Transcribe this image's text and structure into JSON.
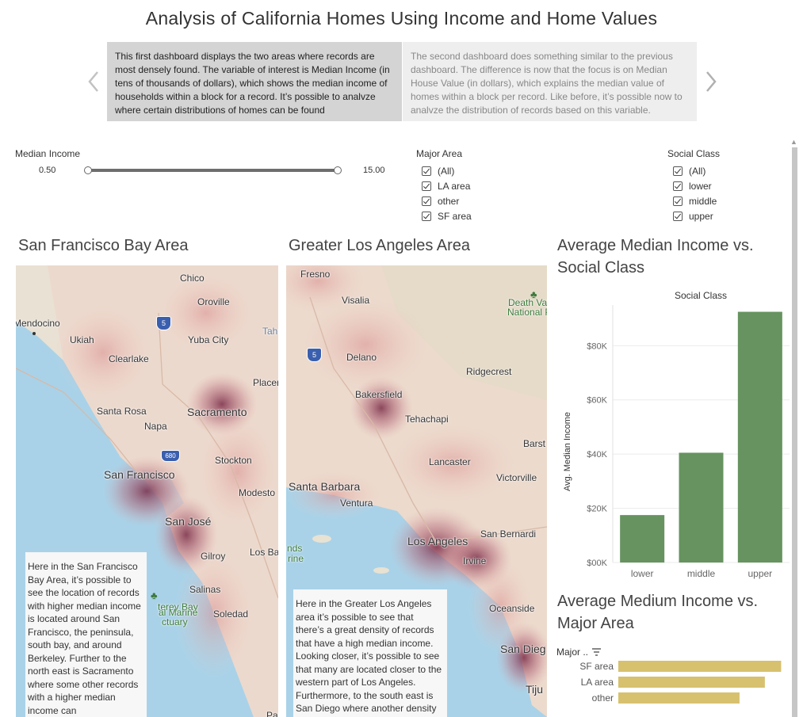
{
  "title": "Analysis of California Homes Using Income and Home Values",
  "story": {
    "prev_icon": "chevron-left-icon",
    "next_icon": "chevron-right-icon",
    "points": [
      "This first dashboard displays the two areas where records are most densely found. The variable of interest is Median Income (in tens of thousands of dollars), which shows the median income of households within a block for a record. It’s possible to analvze where certain distributions of homes can be found",
      "The second dashboard does something similar to the previous dashboard. The difference is now that the focus is on Median House Value (in dollars), which explains the median value of homes within a block per record. Like before, it’s possible now to analvze the distribution of records based on this variable."
    ]
  },
  "filters": {
    "median_income": {
      "title": "Median Income",
      "min_label": "0.50",
      "max_label": "15.00",
      "selected_fraction": [
        0.0,
        1.0
      ]
    },
    "major_area": {
      "title": "Major Area",
      "options": [
        "(All)",
        "LA area",
        "other",
        "SF area"
      ]
    },
    "social_class": {
      "title": "Social Class",
      "options": [
        "(All)",
        "lower",
        "middle",
        "upper"
      ]
    }
  },
  "sf_map": {
    "title": "San Francisco Bay Area",
    "cities": [
      "Chico",
      "Oroville",
      "Mendocino",
      "Ukiah",
      "Yuba City",
      "Clearlake",
      "Tahoe",
      "Placer",
      "Santa Rosa",
      "Sacramento",
      "Napa",
      "Stockton",
      "San Francisco",
      "Modesto",
      "San José",
      "Gilroy",
      "Los Ba",
      "Salinas",
      "Soledad",
      "terey Bay",
      "al Marine",
      "ctuary",
      "Paso"
    ],
    "shields": [
      "5",
      "680"
    ],
    "note": "Here in the San Francisco Bay Area, it’s possible to see the location of records with higher median income is located around San Francisco, the peninsula, south bay, and around Berkeley. Further to the north east is Sacramento where some other records with a higher median income can"
  },
  "la_map": {
    "title": "Greater Los Angeles Area",
    "cities": [
      "Fresno",
      "Visalia",
      "Death Val",
      "National P",
      "Delano",
      "Ridgecrest",
      "Bakersfield",
      "Tehachapi",
      "Barst",
      "Lancaster",
      "Victorville",
      "Santa Barbara",
      "Ventura",
      "Los Angeles",
      "San Bernardi",
      "Irvine",
      "nds",
      "rine",
      "Oceanside",
      "San Dieg",
      "Tiju"
    ],
    "shields": [
      "5"
    ],
    "note": "Here in the Greater Los Angeles area it’s possible to see that there’s a great density of records that have a high median income. Looking closer, it’s possible to see that many are located closer to the western part of Los Angeles. Furthermore, to the south east is San Diego where another density of records with a"
  },
  "bar_chart": {
    "title": "Average Median Income vs. Social Class",
    "header": "Social Class",
    "ylabel": "Avg. Median Income",
    "ytick_labels": [
      "$00K",
      "$20K",
      "$40K",
      "$60K",
      "$80K"
    ],
    "color": "#66935f"
  },
  "hbar_chart": {
    "title": "Average Medium Income vs. Major Area",
    "header": "Major ..",
    "color": "#d7c16f"
  },
  "chart_data": [
    {
      "type": "bar",
      "title": "Average Median Income vs. Social Class",
      "xlabel": "Social Class",
      "ylabel": "Avg. Median Income",
      "categories": [
        "lower",
        "middle",
        "upper"
      ],
      "values": [
        17500,
        40500,
        92500
      ],
      "ylim": [
        0,
        95000
      ],
      "yticks": [
        0,
        20000,
        40000,
        60000,
        80000
      ],
      "grid": true
    },
    {
      "type": "bar",
      "orientation": "horizontal",
      "title": "Average Medium Income vs. Major Area",
      "ylabel": "Major ..",
      "categories": [
        "SF area",
        "LA area",
        "other"
      ],
      "values": [
        45000,
        40500,
        33500
      ],
      "xlim": [
        0,
        46000
      ]
    }
  ]
}
